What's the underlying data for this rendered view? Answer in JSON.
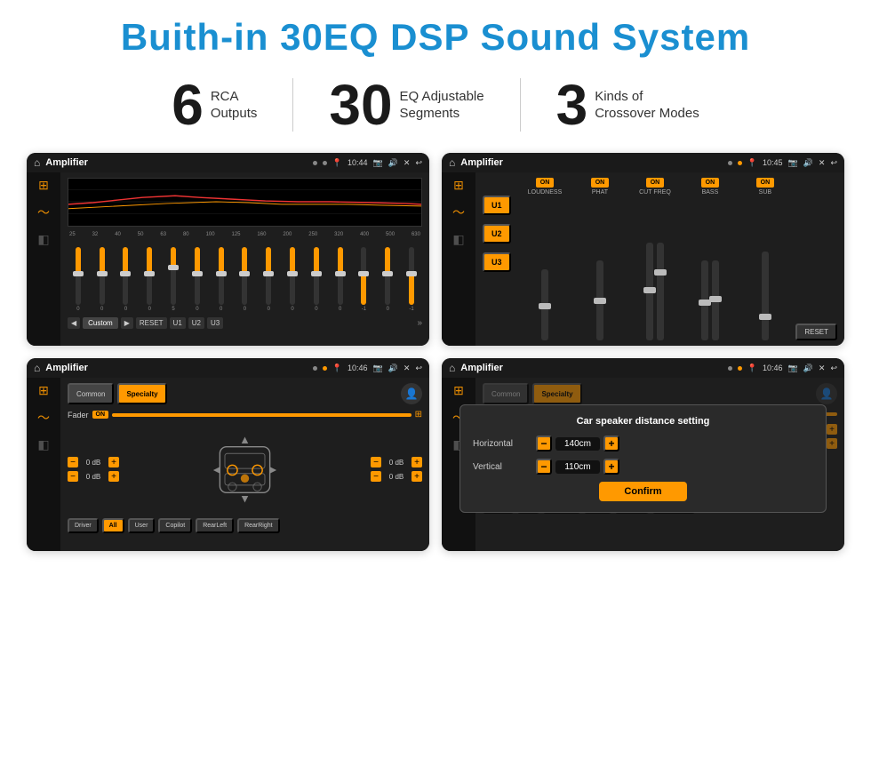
{
  "header": {
    "title": "Buith-in 30EQ DSP Sound System"
  },
  "stats": [
    {
      "number": "6",
      "label": "RCA\nOutputs"
    },
    {
      "number": "30",
      "label": "EQ Adjustable\nSegments"
    },
    {
      "number": "3",
      "label": "Kinds of\nCrossover Modes"
    }
  ],
  "screens": [
    {
      "id": "eq-screen",
      "statusbar": {
        "title": "Amplifier",
        "time": "10:44",
        "dots": [
          "gray",
          "gray"
        ]
      },
      "type": "eq"
    },
    {
      "id": "crossover-screen",
      "statusbar": {
        "title": "Amplifier",
        "time": "10:45",
        "dots": [
          "gray",
          "orange"
        ]
      },
      "type": "crossover"
    },
    {
      "id": "speaker-screen",
      "statusbar": {
        "title": "Amplifier",
        "time": "10:46",
        "dots": [
          "gray",
          "orange"
        ]
      },
      "type": "speaker"
    },
    {
      "id": "dialog-screen",
      "statusbar": {
        "title": "Amplifier",
        "time": "10:46",
        "dots": [
          "gray",
          "orange"
        ]
      },
      "type": "dialog",
      "dialog": {
        "title": "Car speaker distance setting",
        "horizontal_label": "Horizontal",
        "horizontal_value": "140cm",
        "vertical_label": "Vertical",
        "vertical_value": "110cm",
        "confirm_label": "Confirm"
      }
    }
  ],
  "eq": {
    "frequencies": [
      "25",
      "32",
      "40",
      "50",
      "63",
      "80",
      "100",
      "125",
      "160",
      "200",
      "250",
      "320",
      "400",
      "500",
      "630"
    ],
    "values": [
      "0",
      "0",
      "0",
      "0",
      "5",
      "0",
      "0",
      "0",
      "0",
      "0",
      "0",
      "0",
      "-1",
      "0",
      "-1"
    ],
    "buttons": [
      "Custom",
      "RESET",
      "U1",
      "U2",
      "U3"
    ]
  },
  "crossover": {
    "u_buttons": [
      "U1",
      "U2",
      "U3"
    ],
    "channels": [
      "LOUDNESS",
      "PHAT",
      "CUT FREQ",
      "BASS",
      "SUB"
    ],
    "reset_label": "RESET"
  },
  "speaker": {
    "tabs": [
      "Common",
      "Specialty"
    ],
    "fader_label": "Fader",
    "fader_on": "ON",
    "db_values": [
      "0 dB",
      "0 dB",
      "0 dB",
      "0 dB"
    ],
    "bottom_buttons": [
      "Driver",
      "RearLeft",
      "All",
      "User",
      "Copilot",
      "RearRight"
    ]
  },
  "dialog": {
    "title": "Car speaker distance setting",
    "horizontal_label": "Horizontal",
    "horizontal_value": "140cm",
    "vertical_label": "Vertical",
    "vertical_value": "110cm",
    "confirm_label": "Confirm"
  }
}
